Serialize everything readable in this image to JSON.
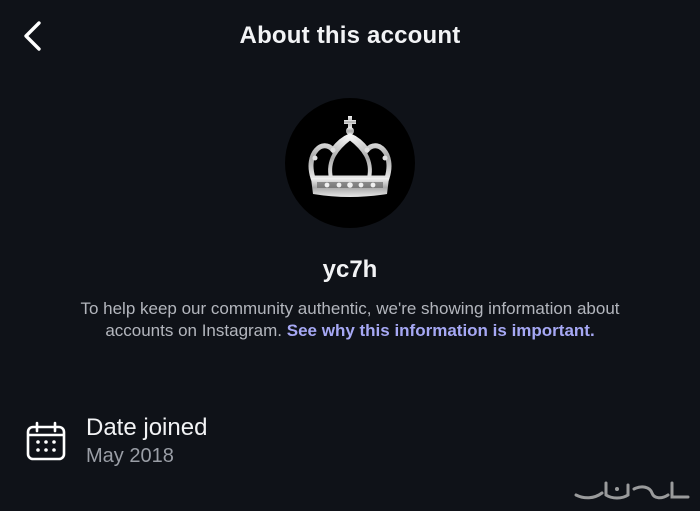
{
  "header": {
    "title": "About this account",
    "back_icon": "chevron-left-icon"
  },
  "profile": {
    "avatar_icon": "crown-icon",
    "username": "yc7h"
  },
  "info": {
    "text": "To help keep our community authentic, we're showing information about accounts on Instagram. ",
    "link_text": "See why this information is important."
  },
  "details": {
    "date_joined": {
      "icon": "calendar-icon",
      "label": "Date joined",
      "value": "May 2018"
    }
  },
  "watermark": {
    "text": "حراج"
  },
  "colors": {
    "background": "#0f1218",
    "link": "#a6a8f4",
    "secondary_text": "#9a9ea6"
  }
}
